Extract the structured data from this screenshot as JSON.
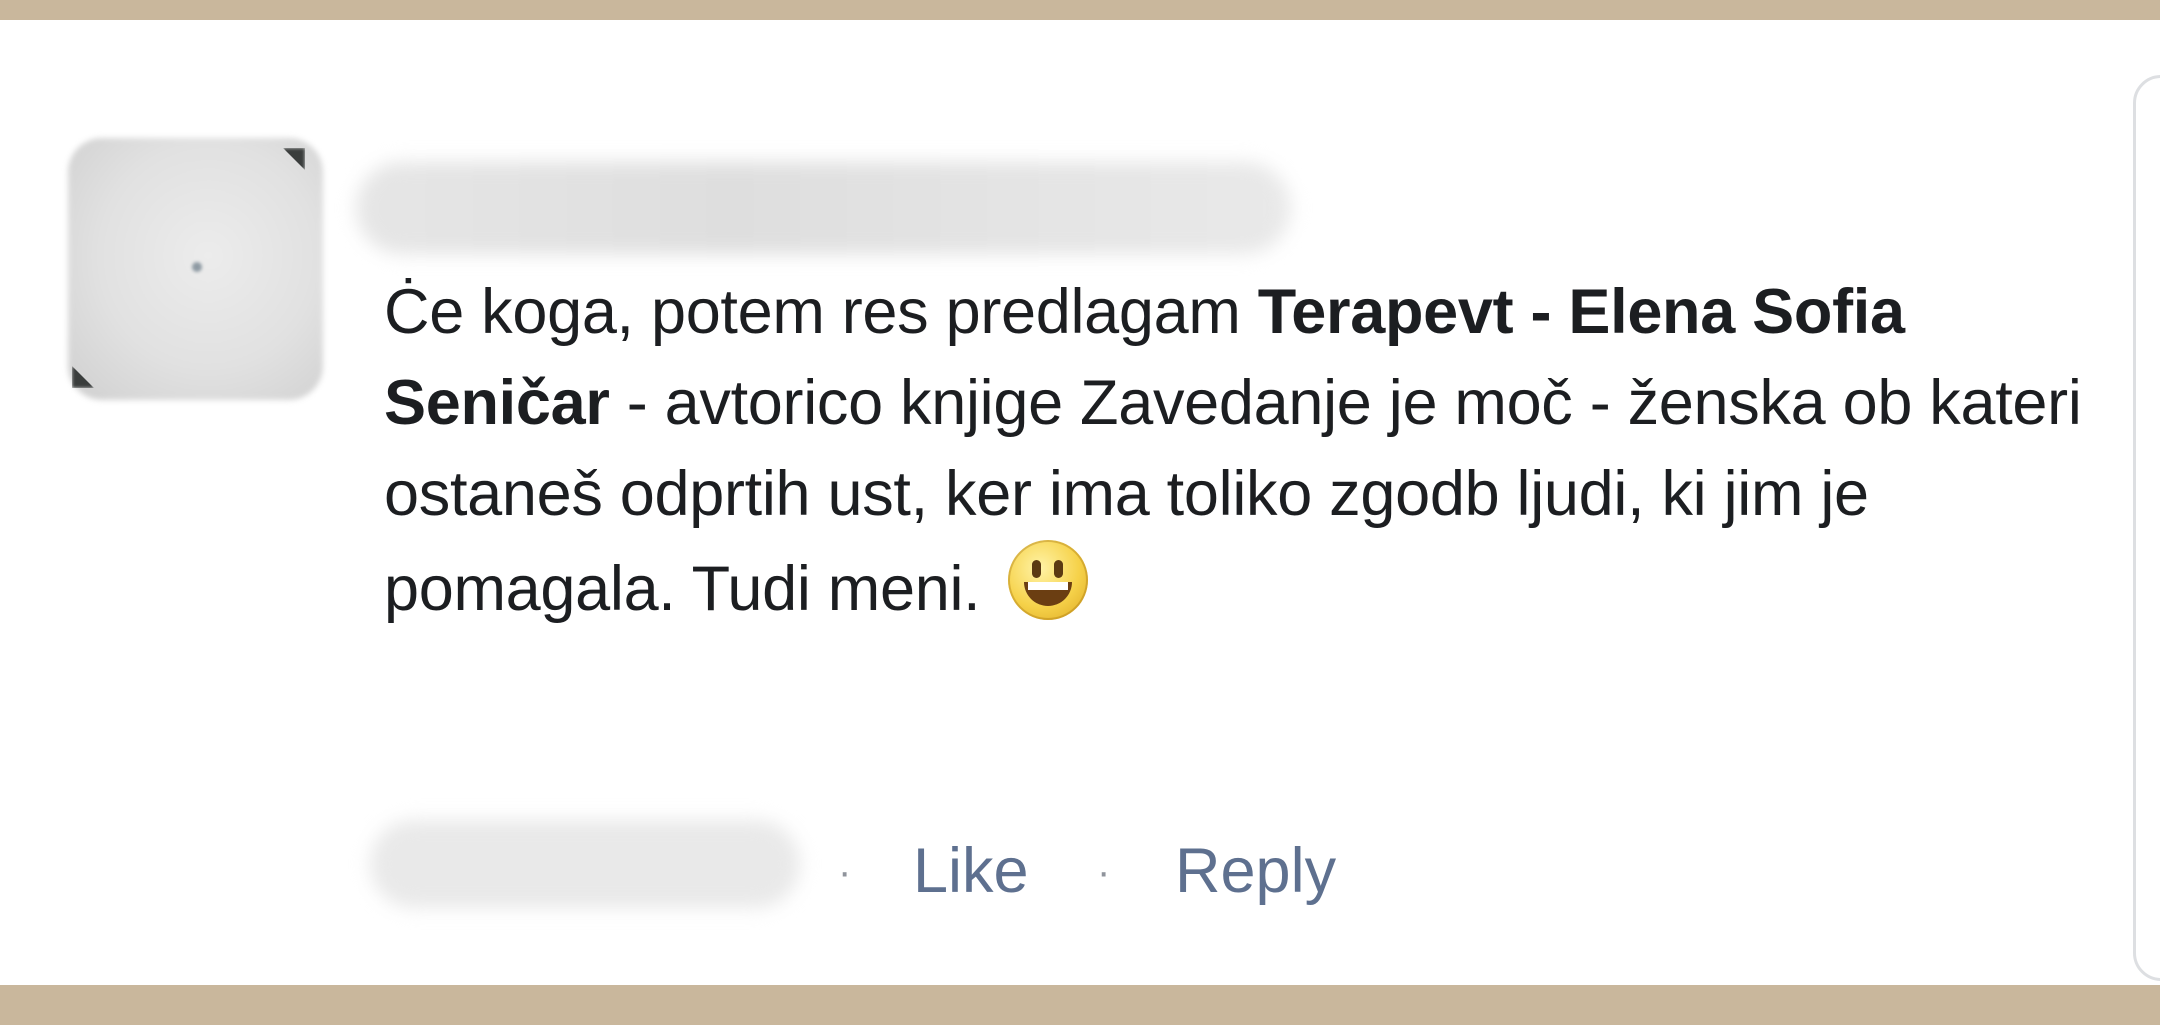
{
  "comment": {
    "text_part1": "Ċe koga, potem res predlagam ",
    "bold_name": "Terapevt - Elena Sofia Seničar",
    "text_part2": " - avtorico knjige Zavedanje je moč - ženska ob kateri ostaneš odprtih ust, ker ima toliko zgodb ljudi, ki jim je pomagala. Tudi meni. ",
    "emoji_icon": "grinning-face-icon"
  },
  "actions": {
    "separator": "·",
    "like_label": "Like",
    "reply_label": "Reply"
  },
  "colors": {
    "frame_border": "#c9b79c",
    "text": "#1c1e21",
    "link": "#5e708f",
    "separator": "#90949c"
  }
}
